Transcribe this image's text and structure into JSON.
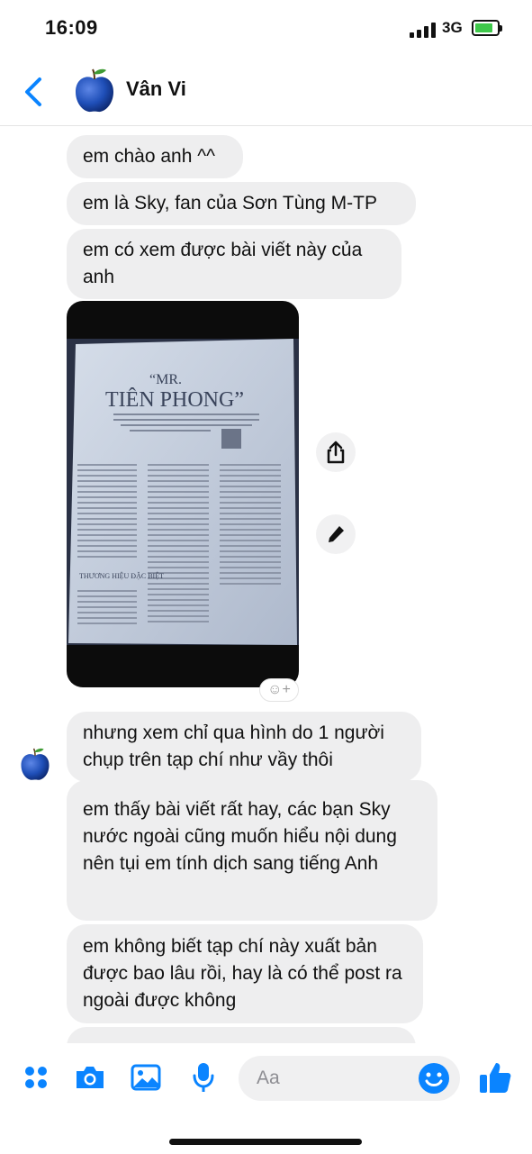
{
  "status": {
    "time": "16:09",
    "network": "3G"
  },
  "header": {
    "contact_name": "Vân Vi"
  },
  "messages": [
    "em chào anh ^^",
    "em là Sky, fan của Sơn Tùng M-TP",
    "em có xem được bài viết này của anh",
    "nhưng xem chỉ qua hình do 1 người chụp trên tạp chí như vầy thôi",
    "em thấy bài viết rất hay, các bạn Sky nước ngoài cũng muốn hiểu nội dung nên tụi em tính dịch sang tiếng Anh",
    "em không biết tạp chí này xuất bản được bao lâu rồi, hay là có thể post ra ngoài được không"
  ],
  "photo": {
    "title_line1": "“MR.",
    "title_line2": "TIÊN PHONG”",
    "subhead": "THƯƠNG HIỆU ĐẶC BIỆT"
  },
  "composer": {
    "placeholder": "Aa"
  },
  "colors": {
    "accent": "#0a84ff",
    "bubble": "#eeeeef",
    "avatar": "#1f4fb8"
  }
}
